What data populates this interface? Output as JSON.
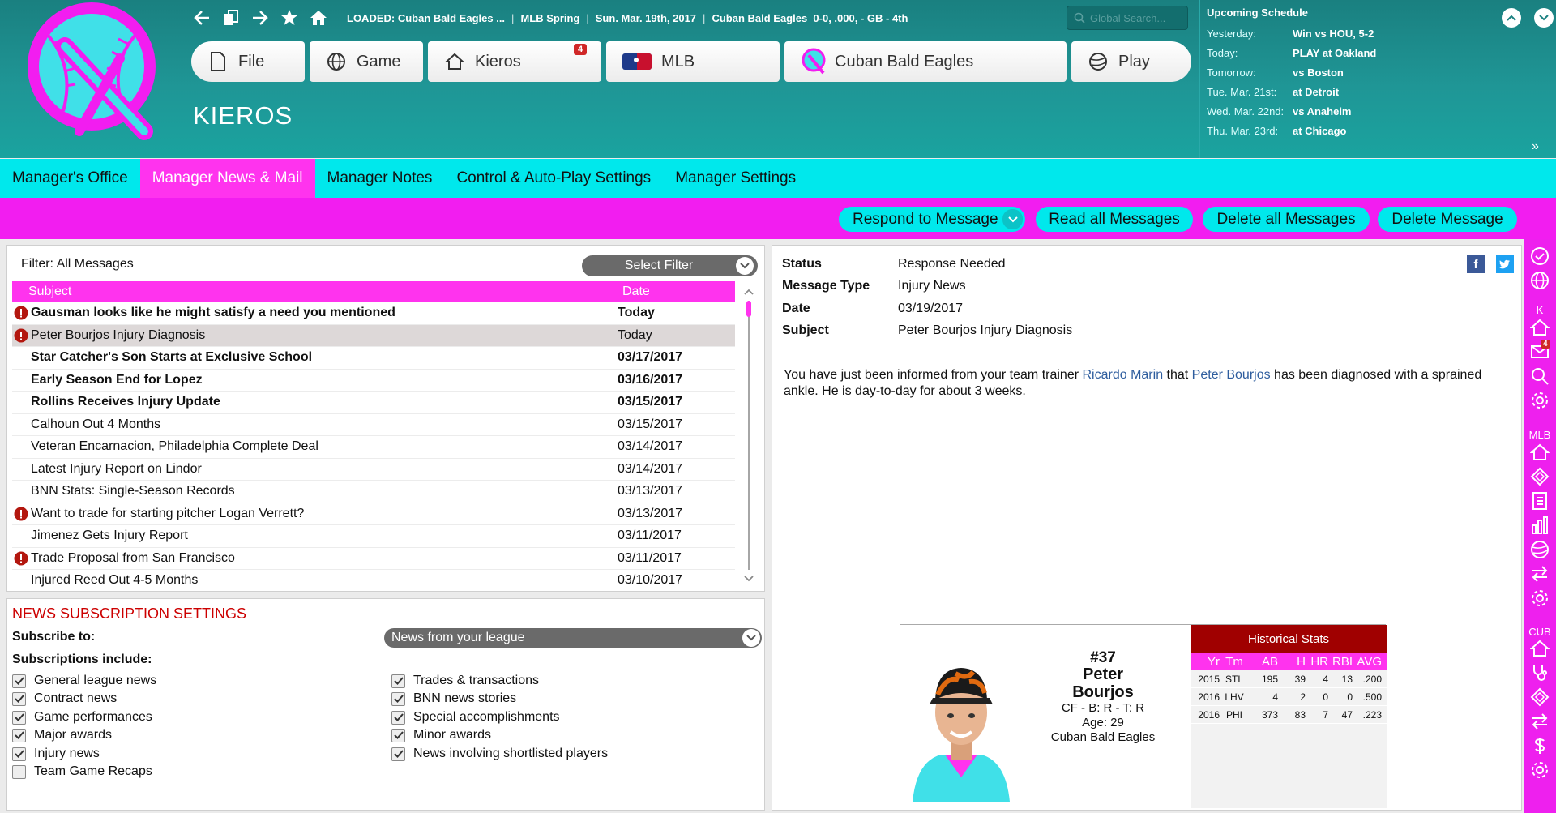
{
  "toolbar": {
    "loaded_label": "LOADED:",
    "loaded_team": "Cuban Bald Eagles ...",
    "league": "MLB Spring",
    "date": "Sun. Mar. 19th, 2017",
    "team": "Cuban Bald Eagles",
    "record": "0-0, .000, - GB - 4th",
    "search_placeholder": "Global Search..."
  },
  "nav": {
    "file": "File",
    "game": "Game",
    "kieros": "Kieros",
    "kieros_badge": "4",
    "mlb": "MLB",
    "team": "Cuban Bald Eagles",
    "play": "Play"
  },
  "page_title": "KIEROS",
  "schedule": {
    "title": "Upcoming Schedule",
    "rows": [
      {
        "day": "Yesterday:",
        "event": "Win vs HOU, 5-2"
      },
      {
        "day": "Today:",
        "event": "PLAY at Oakland"
      },
      {
        "day": "Tomorrow:",
        "event": "vs Boston"
      },
      {
        "day": "Tue. Mar. 21st:",
        "event": "at Detroit"
      },
      {
        "day": "Wed. Mar. 22nd:",
        "event": "vs Anaheim"
      },
      {
        "day": "Thu. Mar. 23rd:",
        "event": "at Chicago"
      }
    ]
  },
  "tabs": [
    "Manager's Office",
    "Manager News & Mail",
    "Manager Notes",
    "Control & Auto-Play Settings",
    "Manager Settings"
  ],
  "actions": {
    "respond": "Respond to Message",
    "read_all": "Read all Messages",
    "delete_all": "Delete all Messages",
    "delete": "Delete Message"
  },
  "filter": {
    "label": "Filter: All Messages",
    "select": "Select Filter"
  },
  "messages": {
    "col_subject": "Subject",
    "col_date": "Date",
    "rows": [
      {
        "subject": "Gausman looks like he might satisfy a need you mentioned",
        "date": "Today"
      },
      {
        "subject": "Peter Bourjos Injury Diagnosis",
        "date": "Today"
      },
      {
        "subject": "Star Catcher's Son Starts at Exclusive School",
        "date": "03/17/2017"
      },
      {
        "subject": "Early Season End for Lopez",
        "date": "03/16/2017"
      },
      {
        "subject": "Rollins Receives Injury Update",
        "date": "03/15/2017"
      },
      {
        "subject": "Calhoun Out 4 Months",
        "date": "03/15/2017"
      },
      {
        "subject": "Veteran Encarnacion, Philadelphia Complete Deal",
        "date": "03/14/2017"
      },
      {
        "subject": "Latest Injury Report on Lindor",
        "date": "03/14/2017"
      },
      {
        "subject": "BNN Stats: Single-Season Records",
        "date": "03/13/2017"
      },
      {
        "subject": "Want to trade for starting pitcher Logan Verrett?",
        "date": "03/13/2017"
      },
      {
        "subject": "Jimenez Gets Injury Report",
        "date": "03/11/2017"
      },
      {
        "subject": "Trade Proposal from San Francisco",
        "date": "03/11/2017"
      },
      {
        "subject": "Injured Reed Out 4-5 Months",
        "date": "03/10/2017"
      }
    ]
  },
  "subscriptions": {
    "title": "NEWS SUBSCRIPTION SETTINGS",
    "subscribe_to": "Subscribe to:",
    "subscribe_value": "News from your league",
    "includes": "Subscriptions include:",
    "left": [
      "General league news",
      "Contract news",
      "Game performances",
      "Major awards",
      "Injury news",
      "Team Game Recaps"
    ],
    "right": [
      "Trades & transactions",
      "BNN news stories",
      "Special accomplishments",
      "Minor awards",
      "News involving shortlisted players"
    ]
  },
  "detail": {
    "status_label": "Status",
    "status": "Response Needed",
    "type_label": "Message Type",
    "type": "Injury News",
    "date_label": "Date",
    "date": "03/19/2017",
    "subject_label": "Subject",
    "subject": "Peter Bourjos Injury Diagnosis",
    "body_1": "You have just been informed from your team trainer ",
    "trainer": "Ricardo Marin",
    "body_2": " that ",
    "player": "Peter Bourjos",
    "body_3": " has been diagnosed with a sprained ankle. He is day-to-day for about 3 weeks."
  },
  "card": {
    "number": "#37",
    "first": "Peter",
    "last": "Bourjos",
    "pos": "CF - B: R - T: R",
    "age": "Age: 29",
    "team": "Cuban Bald Eagles",
    "hist_title": "Historical Stats",
    "hist_cols": [
      "Yr",
      "Tm",
      "AB",
      "H",
      "HR",
      "RBI",
      "AVG"
    ],
    "hist_rows": [
      [
        "2015",
        "STL",
        "195",
        "39",
        "4",
        "13",
        ".200"
      ],
      [
        "2016",
        "LHV",
        "4",
        "2",
        "0",
        "0",
        ".500"
      ],
      [
        "2016",
        "PHI",
        "373",
        "83",
        "7",
        "47",
        ".223"
      ]
    ]
  },
  "rightbar": {
    "k": "K",
    "mlb": "MLB",
    "cub": "CUB",
    "mail_badge": "4"
  }
}
